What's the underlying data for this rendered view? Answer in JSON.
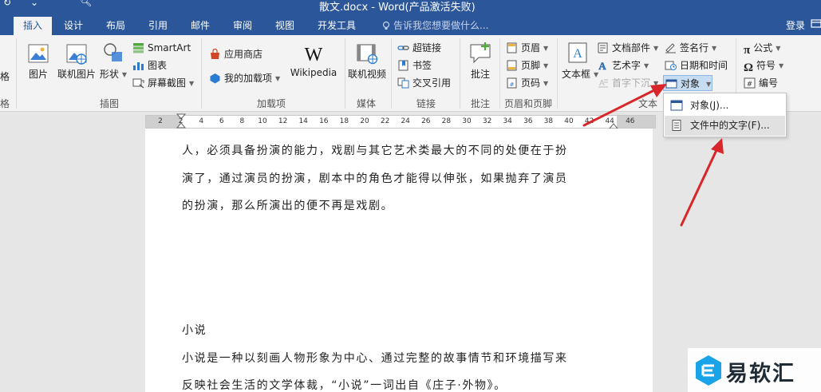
{
  "window": {
    "title": "散文.docx - Word(产品激活失败)"
  },
  "tabs": [
    {
      "label": "插入",
      "active": true
    },
    {
      "label": "设计"
    },
    {
      "label": "布局"
    },
    {
      "label": "引用"
    },
    {
      "label": "邮件"
    },
    {
      "label": "审阅"
    },
    {
      "label": "视图"
    },
    {
      "label": "开发工具"
    }
  ],
  "tell_me": "告诉我您想要做什么...",
  "login": "登录",
  "ribbon": {
    "illustrations": {
      "picture": "图片",
      "online_picture": "联机图片",
      "shapes": "形状",
      "smartart": "SmartArt",
      "chart": "图表",
      "screenshot": "屏幕截图",
      "group_label": "插图"
    },
    "addins": {
      "store": "应用商店",
      "my_addins": "我的加载项",
      "wikipedia": "Wikipedia",
      "group_label": "加载项"
    },
    "media": {
      "online_video": "联机视频",
      "group_label": "媒体"
    },
    "links": {
      "hyperlink": "超链接",
      "bookmark": "书签",
      "cross_reference": "交叉引用",
      "group_label": "链接"
    },
    "comments": {
      "comment": "批注",
      "group_label": "批注"
    },
    "header_footer": {
      "header": "页眉",
      "footer": "页脚",
      "page_number": "页码",
      "group_label": "页眉和页脚"
    },
    "text": {
      "text_box": "文本框",
      "quick_parts": "文档部件",
      "wordart": "艺术字",
      "drop_cap": "首字下沉",
      "signature_line": "签名行",
      "date_time": "日期和时间",
      "object": "对象",
      "group_label": "文本"
    },
    "symbols": {
      "equation": "公式",
      "symbol": "符号",
      "number": "编号"
    },
    "left_cut": {
      "partial_label": "格",
      "partial_group": "格"
    }
  },
  "ruler_ticks": [
    "2",
    "2",
    "4",
    "6",
    "8",
    "10",
    "12",
    "14",
    "16",
    "18",
    "20",
    "22",
    "24",
    "26",
    "28",
    "30",
    "32",
    "34",
    "36",
    "38",
    "40",
    "42",
    "44",
    "46"
  ],
  "object_menu": {
    "items": [
      {
        "label": "对象(J)..."
      },
      {
        "label": "文件中的文字(F)..."
      }
    ]
  },
  "document": {
    "lines": [
      "人，必须具备扮演的能力，戏剧与其它艺术类最大的不同的处便在于扮",
      "演了，通过演员的扮演，剧本中的角色才能得以伸张，如果抛弃了演员",
      "的扮演，那么所演出的便不再是戏剧。",
      "小说",
      "小说是一种以刻画人物形象为中心、通过完整的故事情节和环境描写来",
      "反映社会生活的文学体裁，“小说”一词出自《庄子·外物》。"
    ]
  },
  "watermark": {
    "text": "易软汇"
  },
  "colors": {
    "ribbon_blue": "#2b579a",
    "arrow_red": "#d9262b"
  }
}
